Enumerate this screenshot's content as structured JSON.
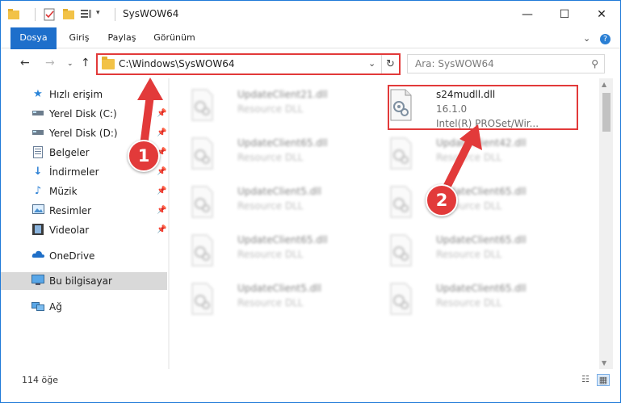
{
  "window": {
    "title": "SysWOW64",
    "controls": {
      "minimize": "—",
      "maximize": "☐",
      "close": "✕"
    }
  },
  "ribbon": {
    "tabs": [
      "Dosya",
      "Giriş",
      "Paylaş",
      "Görünüm"
    ],
    "collapse_icon": "⌄",
    "help_icon": "?"
  },
  "nav": {
    "address": "C:\\Windows\\SysWOW64",
    "search_placeholder": "Ara: SysWOW64"
  },
  "sidebar": {
    "items": [
      {
        "label": "Hızlı erişim",
        "icon": "star-icon",
        "pinned": false
      },
      {
        "label": "Yerel Disk (C:)",
        "icon": "drive-icon",
        "pinned": true
      },
      {
        "label": "Yerel Disk (D:)",
        "icon": "drive-icon",
        "pinned": true
      },
      {
        "label": "Belgeler",
        "icon": "document-icon",
        "pinned": true
      },
      {
        "label": "İndirmeler",
        "icon": "download-icon",
        "pinned": true
      },
      {
        "label": "Müzik",
        "icon": "music-icon",
        "pinned": true
      },
      {
        "label": "Resimler",
        "icon": "picture-icon",
        "pinned": true
      },
      {
        "label": "Videolar",
        "icon": "video-icon",
        "pinned": true
      },
      {
        "label": "OneDrive",
        "icon": "cloud-icon",
        "pinned": false
      },
      {
        "label": "Bu bilgisayar",
        "icon": "computer-icon",
        "pinned": false
      },
      {
        "label": "Ağ",
        "icon": "network-icon",
        "pinned": false
      }
    ]
  },
  "files": {
    "left": [
      {
        "name": "UpdateClient21.dll",
        "desc": "Resource DLL"
      },
      {
        "name": "UpdateClient65.dll",
        "desc": "Resource DLL"
      },
      {
        "name": "UpdateClient5.dll",
        "desc": "Resource DLL"
      },
      {
        "name": "UpdateClient65.dll",
        "desc": "Resource DLL"
      },
      {
        "name": "UpdateClient5.dll",
        "desc": "Resource DLL"
      }
    ],
    "highlighted": {
      "name": "s24mudll.dll",
      "version": "16.1.0",
      "company": "Intel(R) PROSet/Wir..."
    },
    "right": [
      {
        "name": "UpdateClient42.dll",
        "desc": "Resource DLL"
      },
      {
        "name": "UpdateClient65.dll",
        "desc": "Resource DLL"
      },
      {
        "name": "UpdateClient65.dll",
        "desc": "Resource DLL"
      },
      {
        "name": "UpdateClient65.dll",
        "desc": "Resource DLL"
      }
    ]
  },
  "status": {
    "count": "114 öğe"
  },
  "callouts": {
    "one": "1",
    "two": "2"
  },
  "colors": {
    "accent": "#1e6fcb",
    "highlight": "#e23a3a",
    "folder": "#f2c247"
  }
}
